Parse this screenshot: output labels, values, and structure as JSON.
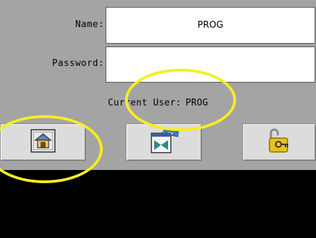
{
  "login_form": {
    "name_label": "Name:",
    "name_value": "PROG",
    "password_label": "Password:",
    "password_value": "",
    "current_user_label": "Current User:",
    "current_user_value": "PROG"
  },
  "buttons": [
    {
      "icon": "home-icon"
    },
    {
      "icon": "login-icon"
    },
    {
      "icon": "logout-lock-icon"
    }
  ],
  "colors": {
    "panel_background": "#a4a4a4",
    "highlight": "#f5ef20",
    "lower_area": "#000000"
  }
}
